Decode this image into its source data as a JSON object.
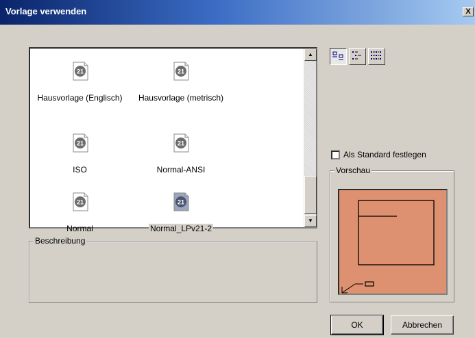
{
  "window": {
    "title": "Vorlage verwenden",
    "close_label": "X"
  },
  "templates": [
    {
      "label": "Hausvorlage (Englisch)",
      "selected": false,
      "icon": "template-file-icon"
    },
    {
      "label": "Hausvorlage (metrisch)",
      "selected": false,
      "icon": "template-file-icon"
    },
    {
      "label": "ISO",
      "selected": false,
      "icon": "template-file-icon"
    },
    {
      "label": "Normal-ANSI",
      "selected": false,
      "icon": "template-file-icon"
    },
    {
      "label": "Normal",
      "selected": false,
      "icon": "template-file-icon"
    },
    {
      "label": "Normal_LPv21-2",
      "selected": true,
      "icon": "template-file-icon"
    }
  ],
  "icon_glyph": "21",
  "scrollbar": {
    "up_arrow": "▲",
    "down_arrow": "▼"
  },
  "view_buttons": [
    {
      "name": "large-icons",
      "active": true
    },
    {
      "name": "list",
      "active": false
    },
    {
      "name": "details",
      "active": false
    }
  ],
  "default_checkbox": {
    "label": "Als Standard festlegen",
    "checked": false
  },
  "preview_group": {
    "label": "Vorschau"
  },
  "description_group": {
    "label": "Beschreibung",
    "text": ""
  },
  "buttons": {
    "ok": "OK",
    "cancel": "Abbrechen"
  },
  "colors": {
    "preview_bg": "#dd9170",
    "title_start": "#0a246a",
    "title_end": "#a6caf0",
    "dialog_bg": "#d4d0c8"
  }
}
